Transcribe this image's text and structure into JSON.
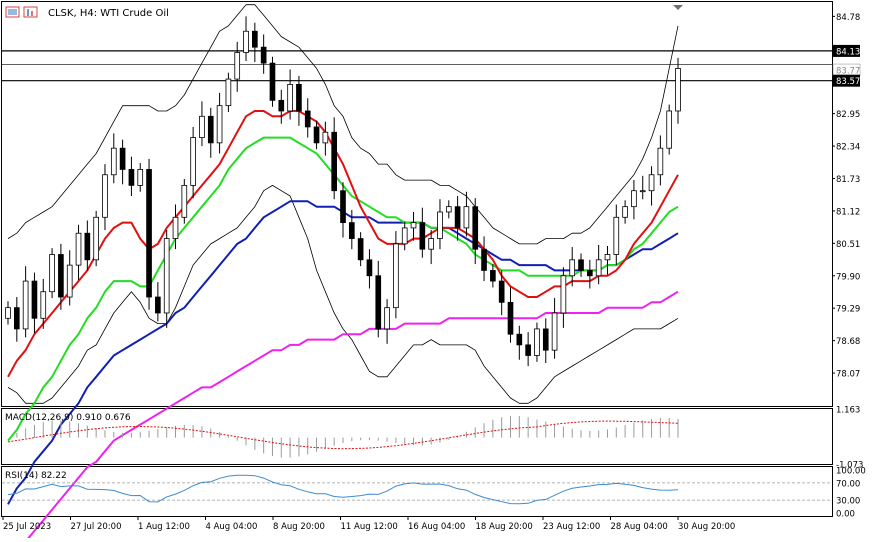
{
  "header": {
    "symbol": "CLSK",
    "timeframe": "H4",
    "instrument": "WTI Crude Oil",
    "title_text": "CLSK, H4:  WTI Crude Oil"
  },
  "colors": {
    "background": "#ffffff",
    "axis": "#000000",
    "grid_dots": "#b9b9b9",
    "candle": "#000000",
    "bull_fill": "#ffffff",
    "ma_red": "#e01010",
    "ma_green": "#22dd22",
    "ma_blue": "#1020b0",
    "ma_magenta": "#ee22ee",
    "bollinger": "#000000",
    "macd_signal": "#e01010",
    "macd_hist": "#9a9a9a",
    "rsi": "#3c8cd0",
    "rsi_levels": "#9a9a9a"
  },
  "chart_data": [
    {
      "type": "line",
      "panel": "price",
      "ylim": [
        77.45,
        85.05
      ],
      "y_ticks": [
        "84.78",
        "84.13",
        "83.77",
        "83.57",
        "82.95",
        "82.34",
        "81.73",
        "81.12",
        "80.51",
        "79.90",
        "79.29",
        "78.68",
        "78.07"
      ],
      "highlighted_levels": [
        "84.13",
        "83.57"
      ],
      "current_price_label": "83.77",
      "horizontal_lines": [
        84.13,
        83.87,
        83.57
      ],
      "x_tick_labels": [
        "25 Jul 2023",
        "27 Jul 20:00",
        "1 Aug 12:00",
        "4 Aug 04:00",
        "8 Aug 20:00",
        "11 Aug 12:00",
        "16 Aug 04:00",
        "18 Aug 20:00",
        "23 Aug 12:00",
        "28 Aug 04:00",
        "30 Aug 20:00"
      ],
      "series": [
        {
          "kind": "close",
          "values": [
            79.3,
            78.9,
            79.8,
            79.1,
            79.6,
            80.3,
            79.5,
            80.1,
            80.7,
            80.2,
            81.0,
            81.8,
            82.3,
            81.9,
            81.6,
            81.9,
            79.5,
            79.2,
            80.6,
            81.0,
            81.6,
            82.5,
            82.9,
            82.4,
            83.1,
            83.6,
            84.1,
            84.5,
            84.2,
            83.9,
            83.2,
            83.0,
            83.5,
            83.0,
            82.7,
            82.4,
            82.6,
            81.5,
            80.9,
            80.6,
            80.2,
            79.9,
            78.9,
            79.3,
            80.5,
            80.8,
            80.9,
            80.4,
            80.6,
            81.1,
            81.2,
            80.8,
            81.2,
            80.4,
            80.0,
            79.8,
            79.4,
            78.8,
            78.6,
            78.4,
            78.9,
            78.5,
            79.2,
            79.9,
            80.2,
            80.0,
            79.9,
            80.2,
            80.3,
            81.0,
            81.2,
            81.5,
            81.5,
            81.8,
            82.3,
            83.0,
            83.8
          ]
        },
        {
          "kind": "bollinger_upper",
          "values": [
            80.6,
            80.7,
            80.9,
            81.0,
            81.1,
            81.2,
            81.4,
            81.6,
            81.8,
            82.0,
            82.2,
            82.5,
            82.8,
            83.1,
            83.1,
            83.1,
            83.1,
            83.0,
            83.0,
            83.1,
            83.3,
            83.6,
            83.9,
            84.2,
            84.5,
            84.6,
            84.8,
            85.0,
            85.0,
            84.8,
            84.6,
            84.4,
            84.3,
            84.2,
            84.0,
            83.8,
            83.5,
            83.1,
            82.9,
            82.5,
            82.3,
            82.2,
            82.0,
            82.0,
            81.8,
            81.7,
            81.7,
            81.7,
            81.7,
            81.6,
            81.6,
            81.5,
            81.4,
            81.2,
            81.0,
            80.8,
            80.7,
            80.6,
            80.5,
            80.5,
            80.5,
            80.6,
            80.6,
            80.6,
            80.7,
            80.7,
            80.8,
            81.0,
            81.2,
            81.4,
            81.6,
            81.8,
            82.1,
            82.5,
            83.0,
            83.8,
            84.6
          ]
        },
        {
          "kind": "bollinger_lower",
          "values": [
            77.8,
            77.7,
            77.5,
            77.5,
            77.5,
            77.6,
            77.8,
            78.0,
            78.2,
            78.5,
            78.6,
            78.9,
            79.2,
            79.4,
            79.6,
            79.4,
            79.1,
            79.0,
            79.0,
            79.3,
            79.7,
            80.1,
            80.3,
            80.5,
            80.6,
            80.7,
            80.8,
            81.0,
            81.2,
            81.5,
            81.6,
            81.5,
            81.4,
            81.0,
            80.6,
            80.0,
            79.6,
            79.2,
            78.9,
            78.7,
            78.4,
            78.1,
            78.0,
            78.0,
            78.2,
            78.4,
            78.6,
            78.6,
            78.7,
            78.6,
            78.6,
            78.6,
            78.6,
            78.5,
            78.2,
            78.0,
            77.8,
            77.6,
            77.5,
            77.5,
            77.6,
            77.8,
            78.0,
            78.1,
            78.2,
            78.3,
            78.4,
            78.5,
            78.6,
            78.7,
            78.8,
            78.9,
            78.9,
            78.9,
            78.9,
            79.0,
            79.1
          ]
        },
        {
          "kind": "ma_red",
          "values": [
            78.0,
            78.3,
            78.5,
            78.8,
            79.0,
            79.2,
            79.4,
            79.6,
            79.8,
            80.0,
            80.3,
            80.6,
            80.8,
            80.9,
            80.9,
            80.6,
            80.4,
            80.5,
            80.8,
            81.0,
            81.2,
            81.4,
            81.6,
            81.8,
            82.0,
            82.3,
            82.6,
            82.9,
            83.0,
            83.0,
            82.9,
            82.9,
            83.0,
            83.0,
            82.9,
            82.8,
            82.6,
            82.3,
            82.0,
            81.6,
            81.2,
            80.9,
            80.6,
            80.5,
            80.5,
            80.5,
            80.6,
            80.6,
            80.7,
            80.8,
            80.8,
            80.8,
            80.7,
            80.6,
            80.4,
            80.2,
            79.9,
            79.7,
            79.6,
            79.5,
            79.5,
            79.6,
            79.7,
            79.7,
            79.8,
            79.8,
            79.8,
            79.9,
            79.9,
            80.0,
            80.2,
            80.5,
            80.7,
            80.9,
            81.2,
            81.5,
            81.8
          ]
        },
        {
          "kind": "ma_green",
          "values": [
            76.8,
            77.0,
            77.3,
            77.5,
            77.8,
            78.0,
            78.3,
            78.6,
            78.8,
            79.1,
            79.3,
            79.6,
            79.8,
            79.8,
            79.8,
            79.7,
            79.7,
            80.0,
            80.3,
            80.6,
            80.8,
            81.0,
            81.2,
            81.4,
            81.6,
            81.9,
            82.1,
            82.3,
            82.4,
            82.5,
            82.5,
            82.5,
            82.5,
            82.4,
            82.3,
            82.2,
            82.0,
            81.8,
            81.6,
            81.4,
            81.3,
            81.2,
            81.1,
            81.0,
            81.0,
            80.9,
            80.9,
            80.9,
            80.8,
            80.8,
            80.7,
            80.6,
            80.5,
            80.3,
            80.2,
            80.1,
            80.0,
            80.0,
            80.0,
            79.9,
            79.9,
            79.9,
            79.9,
            79.9,
            79.9,
            80.0,
            80.0,
            80.0,
            80.1,
            80.1,
            80.2,
            80.4,
            80.5,
            80.7,
            80.9,
            81.1,
            81.2
          ]
        },
        {
          "kind": "ma_blue",
          "values": [
            75.6,
            75.9,
            76.1,
            76.4,
            76.6,
            76.8,
            77.1,
            77.3,
            77.5,
            77.8,
            78.0,
            78.2,
            78.4,
            78.5,
            78.6,
            78.7,
            78.8,
            78.9,
            79.0,
            79.2,
            79.3,
            79.5,
            79.7,
            79.9,
            80.1,
            80.3,
            80.5,
            80.6,
            80.8,
            81.0,
            81.1,
            81.2,
            81.3,
            81.3,
            81.3,
            81.2,
            81.2,
            81.2,
            81.1,
            81.0,
            81.0,
            81.0,
            80.9,
            80.9,
            80.9,
            80.9,
            80.9,
            80.9,
            80.8,
            80.8,
            80.8,
            80.7,
            80.6,
            80.5,
            80.4,
            80.3,
            80.2,
            80.2,
            80.1,
            80.1,
            80.1,
            80.1,
            80.0,
            80.0,
            80.0,
            80.0,
            80.0,
            80.0,
            80.1,
            80.1,
            80.2,
            80.3,
            80.4,
            80.4,
            80.5,
            80.6,
            80.7
          ]
        },
        {
          "kind": "ma_magenta",
          "values": [
            74.5,
            74.7,
            74.9,
            75.1,
            75.3,
            75.5,
            75.7,
            75.9,
            76.1,
            76.3,
            76.4,
            76.6,
            76.8,
            76.9,
            77.0,
            77.1,
            77.2,
            77.3,
            77.4,
            77.5,
            77.6,
            77.7,
            77.8,
            77.8,
            77.9,
            78.0,
            78.1,
            78.2,
            78.3,
            78.4,
            78.5,
            78.5,
            78.6,
            78.6,
            78.7,
            78.7,
            78.7,
            78.7,
            78.8,
            78.8,
            78.8,
            78.9,
            78.9,
            78.9,
            78.9,
            79.0,
            79.0,
            79.0,
            79.0,
            79.0,
            79.1,
            79.1,
            79.1,
            79.1,
            79.1,
            79.1,
            79.1,
            79.1,
            79.1,
            79.1,
            79.1,
            79.2,
            79.2,
            79.2,
            79.2,
            79.2,
            79.2,
            79.2,
            79.3,
            79.3,
            79.3,
            79.3,
            79.3,
            79.4,
            79.4,
            79.5,
            79.6
          ]
        }
      ]
    },
    {
      "type": "bar",
      "panel": "macd",
      "label": "MACD(12,26,9) 0.910 0.676",
      "y_ticks": [
        "1.163",
        "-1.073"
      ],
      "ylim": [
        -1.073,
        1.163
      ]
    },
    {
      "type": "line",
      "panel": "rsi",
      "label": "RSI(14) 82.22",
      "y_ticks": [
        "100.00",
        "70.00",
        "30.00",
        "0.00"
      ],
      "ylim": [
        0,
        100
      ],
      "levels": [
        70,
        30
      ]
    }
  ]
}
